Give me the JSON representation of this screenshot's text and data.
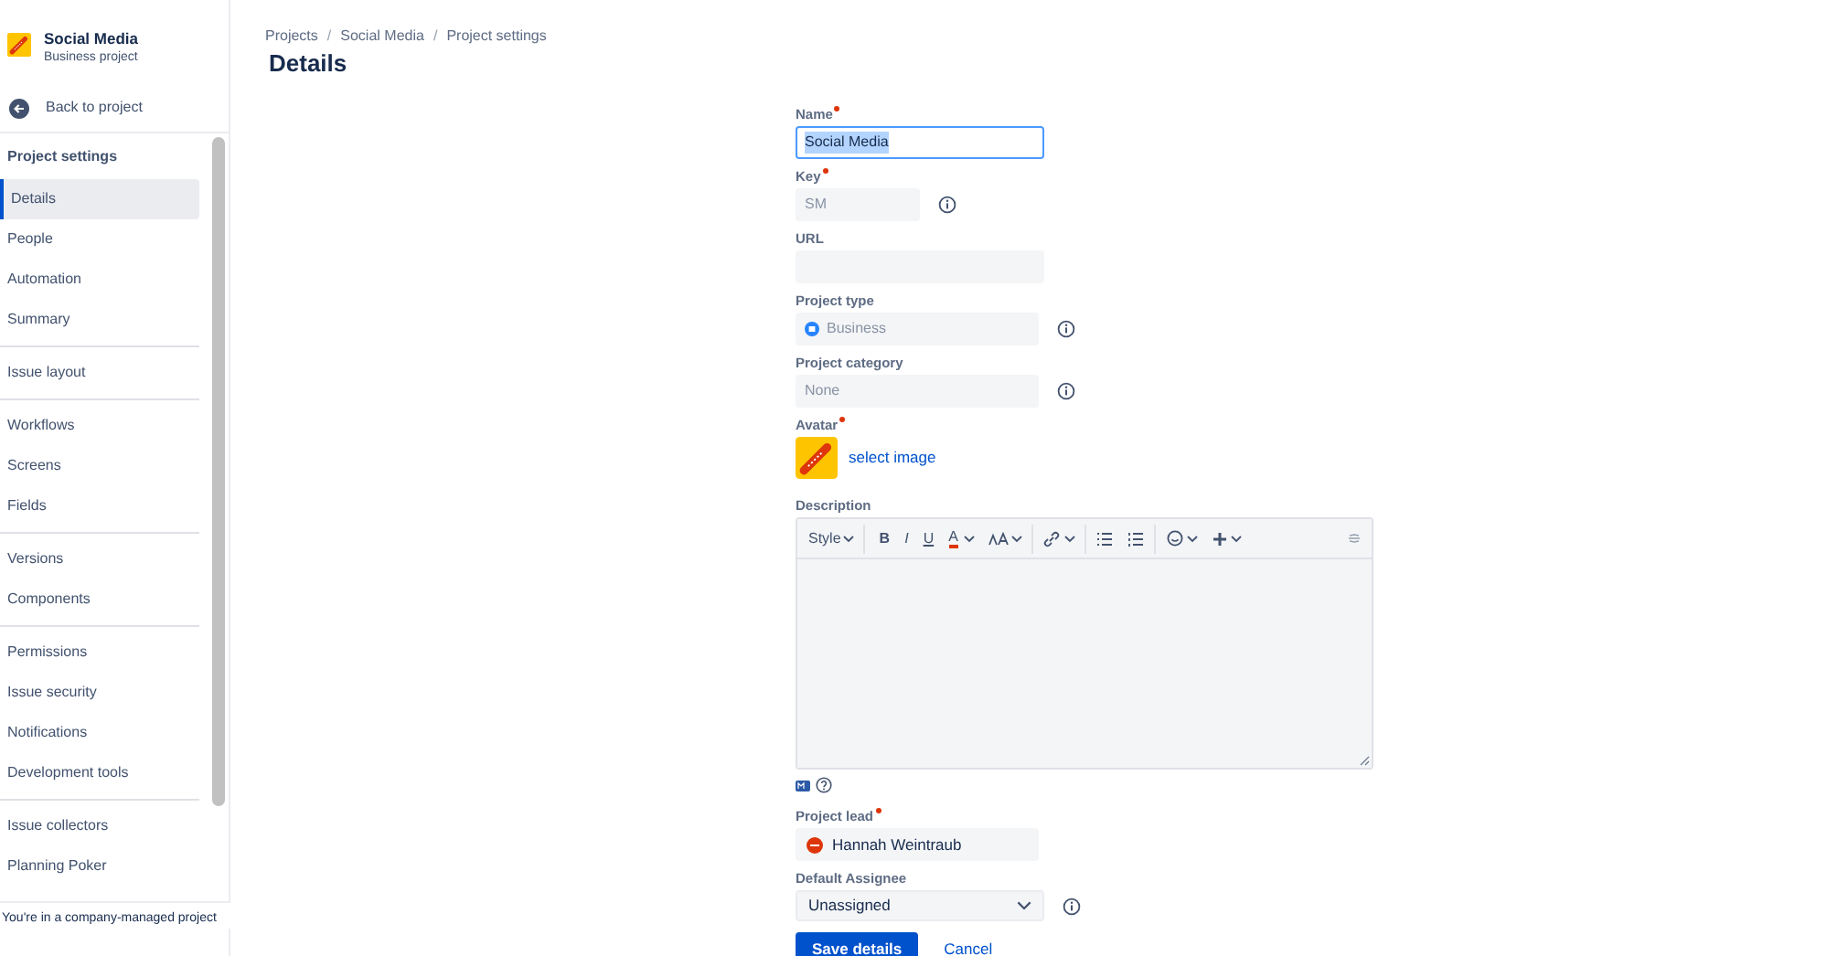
{
  "sidebar": {
    "project": {
      "name": "Social Media",
      "type": "Business project"
    },
    "back_link": "Back to project",
    "section_title": "Project settings",
    "groups": [
      [
        {
          "label": "Details",
          "selected": true
        },
        {
          "label": "People",
          "selected": false
        },
        {
          "label": "Automation",
          "selected": false
        },
        {
          "label": "Summary",
          "selected": false
        }
      ],
      [
        {
          "label": "Issue layout",
          "selected": false
        }
      ],
      [
        {
          "label": "Workflows",
          "selected": false
        },
        {
          "label": "Screens",
          "selected": false
        },
        {
          "label": "Fields",
          "selected": false
        }
      ],
      [
        {
          "label": "Versions",
          "selected": false
        },
        {
          "label": "Components",
          "selected": false
        }
      ],
      [
        {
          "label": "Permissions",
          "selected": false
        },
        {
          "label": "Issue security",
          "selected": false
        },
        {
          "label": "Notifications",
          "selected": false
        },
        {
          "label": "Development tools",
          "selected": false
        }
      ],
      [
        {
          "label": "Issue collectors",
          "selected": false
        },
        {
          "label": "Planning Poker",
          "selected": false
        }
      ]
    ],
    "footer": "You're in a company-managed project"
  },
  "breadcrumbs": [
    "Projects",
    "Social Media",
    "Project settings"
  ],
  "breadcrumb_separator": "/",
  "title": "Details",
  "fields": [
    {
      "kind": "input",
      "label": "Name",
      "required": true,
      "value": "Social Media",
      "focused": true,
      "disabled": false,
      "info": false
    },
    {
      "kind": "short-input",
      "label": "Key",
      "required": true,
      "value": "SM",
      "focused": false,
      "disabled": true,
      "info": true
    },
    {
      "kind": "input",
      "label": "URL",
      "required": false,
      "focused": false,
      "disabled": true,
      "info": false
    },
    {
      "kind": "type",
      "label": "Project type",
      "required": false,
      "value": "Business",
      "disabled": true,
      "info": true
    },
    {
      "kind": "input",
      "label": "Project category",
      "required": false,
      "value": "None",
      "focused": false,
      "disabled": true,
      "info": true
    },
    {
      "kind": "avatar",
      "label": "Avatar",
      "required": true,
      "link": "select image"
    },
    {
      "kind": "editor",
      "label": "Description",
      "required": false,
      "style_label": "Style",
      "format_buttons": [
        "B",
        "I",
        "U",
        "A"
      ]
    },
    {
      "kind": "user",
      "label": "Project lead",
      "required": true,
      "value": "Hannah Weintraub"
    },
    {
      "kind": "select",
      "label": "Default Assignee",
      "required": false,
      "value": "Unassigned",
      "info": true
    }
  ],
  "actions": [
    {
      "label": "Save details",
      "kind": "primary"
    },
    {
      "label": "Cancel",
      "kind": "link"
    }
  ]
}
